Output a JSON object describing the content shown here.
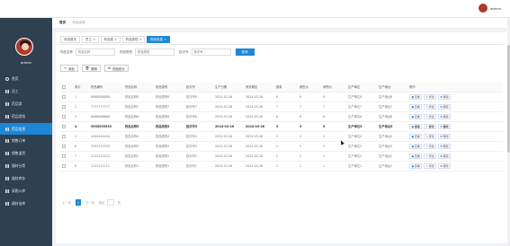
{
  "app": {
    "title": "药品器材销售管理系统"
  },
  "user": {
    "name": "admin"
  },
  "sidebar": {
    "items": [
      {
        "label": "首页",
        "icon": "home-icon"
      },
      {
        "label": "员工",
        "icon": "grid-icon"
      },
      {
        "label": "药品类",
        "icon": "grid-icon"
      },
      {
        "label": "药品类别",
        "icon": "grid-icon"
      },
      {
        "label": "药品信息",
        "icon": "grid-icon"
      },
      {
        "label": "销售订单",
        "icon": "grid-icon"
      },
      {
        "label": "销售退货",
        "icon": "grid-icon"
      },
      {
        "label": "器材分类",
        "icon": "grid-icon"
      },
      {
        "label": "器材库存",
        "icon": "grid-icon"
      },
      {
        "label": "采购入库",
        "icon": "grid-icon"
      },
      {
        "label": "器材出库",
        "icon": "grid-icon"
      }
    ],
    "active_index": 4
  },
  "breadcrumb": {
    "home": "首页",
    "current": "药品信息"
  },
  "tabs": [
    {
      "label": "系统首页"
    },
    {
      "label": "员工"
    },
    {
      "label": "药品类"
    },
    {
      "label": "药品类别"
    },
    {
      "label": "药品信息"
    }
  ],
  "search": {
    "label1": "药品名称",
    "placeholder1": "药品名称",
    "label2": "药品类别",
    "placeholder2": "药品类别",
    "label3": "批次号",
    "placeholder3": "批次号",
    "button": "查询"
  },
  "actions": {
    "add": "添加",
    "delete": "删除",
    "stats": "药品统计"
  },
  "table": {
    "headers": [
      "",
      "索引",
      "药品编号",
      "药品名称",
      "药品类别",
      "批次号",
      "生产日期",
      "有效期至",
      "数量",
      "销售价",
      "采购价",
      "生产单位",
      "生产地址",
      "操作"
    ],
    "rows": [
      [
        "1",
        "8888888888",
        "药品名称8",
        "药品类别8",
        "批次号8",
        "2024-03-26",
        "2024-03-26",
        "8",
        "8",
        "8",
        "生产单位8",
        "生产地址8"
      ],
      [
        "2",
        "7777777777",
        "药品名称7",
        "药品类别7",
        "批次号7",
        "2024-03-26",
        "2024-03-26",
        "7",
        "7",
        "7",
        "生产单位7",
        "生产地址7"
      ],
      [
        "3",
        "6666666666",
        "药品名称6",
        "药品类别6",
        "批次号6",
        "2024-03-26",
        "2024-03-26",
        "6",
        "6",
        "6",
        "生产单位6",
        "生产地址6"
      ],
      [
        "4",
        "5555555555",
        "药品名称5",
        "药品类别5",
        "批次号5",
        "2024-03-26",
        "2024-03-26",
        "5",
        "5",
        "5",
        "生产单位5",
        "生产地址5"
      ],
      [
        "5",
        "4444444444",
        "药品名称4",
        "药品类别4",
        "批次号4",
        "2024-03-26",
        "2024-03-26",
        "4",
        "4",
        "4",
        "生产单位4",
        "生产地址4"
      ],
      [
        "6",
        "3333333333",
        "药品名称3",
        "药品类别3",
        "批次号3",
        "2024-03-26",
        "2024-03-26",
        "3",
        "3",
        "3",
        "生产单位3",
        "生产地址3"
      ],
      [
        "7",
        "2222222222",
        "药品名称2",
        "药品类别2",
        "批次号2",
        "2024-03-26",
        "2024-03-26",
        "2",
        "2",
        "2",
        "生产单位2",
        "生产地址2"
      ],
      [
        "8",
        "1111111111",
        "药品名称1",
        "药品类别1",
        "批次号1",
        "2024-03-26",
        "2024-03-26",
        "1",
        "1",
        "1",
        "生产单位1",
        "生产地址1"
      ]
    ],
    "highlight_index": 3,
    "ops": {
      "view": "查看",
      "edit": "修改",
      "delete": "删除"
    }
  },
  "pager": {
    "prev": "上一页",
    "current": "1",
    "next": "下一页",
    "goto": "前往",
    "unit": "页"
  },
  "colors": {
    "accent": "#1e86d6",
    "sidebar_bg": "#2f4050"
  }
}
